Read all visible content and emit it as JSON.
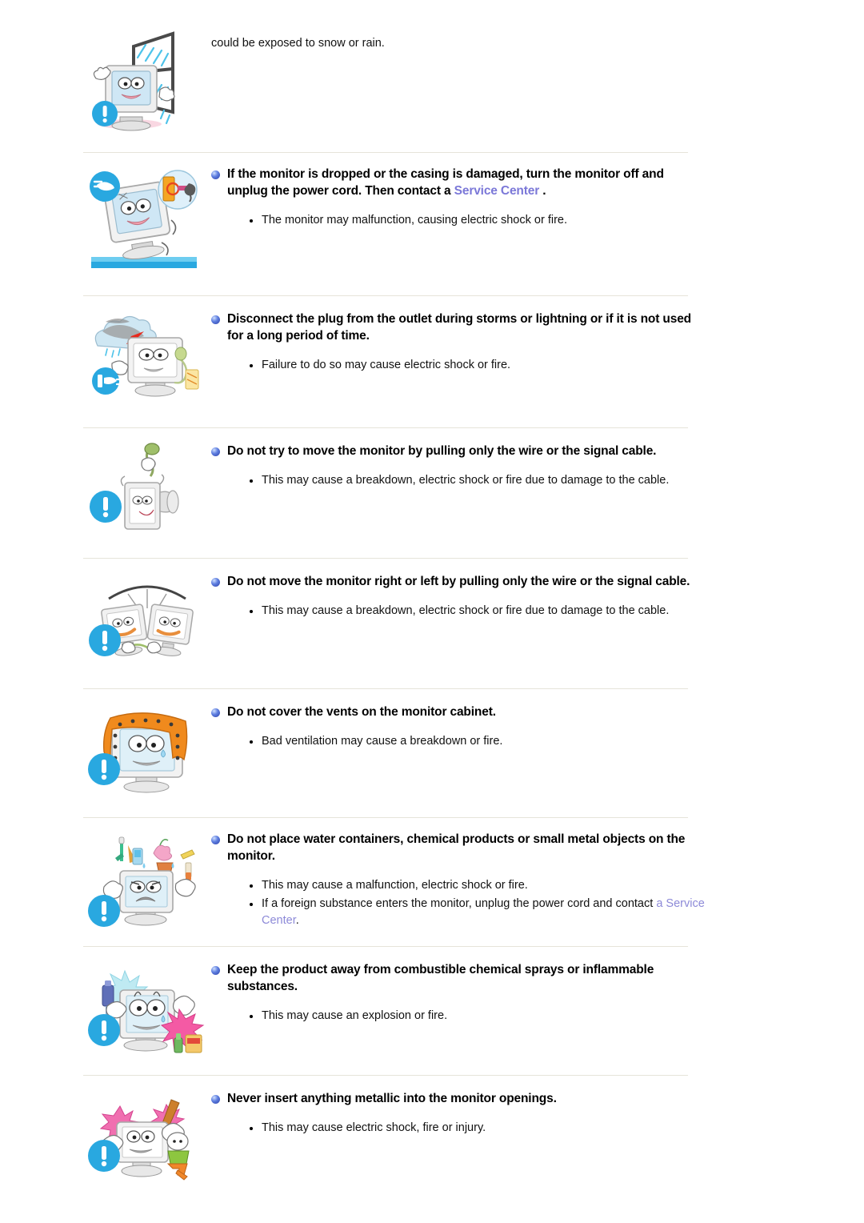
{
  "document": {
    "type": "monitor-safety-manual-page",
    "continued_text": "could be exposed to snow or rain."
  },
  "sections": [
    {
      "id": "snow-rain",
      "kind": "continued",
      "art": "monitor-rain-window",
      "text": "could be exposed to snow or rain."
    },
    {
      "id": "dropped-monitor",
      "kind": "warning",
      "art": "monitor-dropped-cracked",
      "heading_parts": [
        {
          "text": "If the monitor is dropped or the casing is damaged, turn the monitor off and unplug the power cord. Then contact a ",
          "style": "bold"
        },
        {
          "text": "Service Center",
          "style": "link"
        },
        {
          "text": " .",
          "style": "bold"
        }
      ],
      "bullets": [
        "The monitor may malfunction, causing electric shock or fire."
      ]
    },
    {
      "id": "storms-lightning",
      "kind": "warning",
      "art": "monitor-storm-unplug",
      "heading_parts": [
        {
          "text": "Disconnect the plug from the outlet during storms or lightning or if it is not used for a long period of time.",
          "style": "bold"
        }
      ],
      "bullets": [
        "Failure to do so may cause electric shock or fire."
      ]
    },
    {
      "id": "pull-wire-move",
      "kind": "warning",
      "art": "monitor-pull-cable-up",
      "heading_parts": [
        {
          "text": "Do not try to move the monitor by pulling only the wire or the signal cable.",
          "style": "bold"
        }
      ],
      "bullets": [
        "This may cause a breakdown, electric shock or fire due to damage to the cable."
      ]
    },
    {
      "id": "pull-wire-sideways",
      "kind": "warning",
      "art": "monitor-pull-cable-side",
      "heading_parts": [
        {
          "text": "Do not move the monitor right or left by pulling only the wire or the signal cable.",
          "style": "bold"
        }
      ],
      "bullets": [
        "This may cause a breakdown, electric shock or fire due to damage to the cable."
      ]
    },
    {
      "id": "cover-vents",
      "kind": "warning",
      "art": "monitor-covered-cloth",
      "heading_parts": [
        {
          "text": "Do not cover the vents on the monitor cabinet.",
          "style": "bold"
        }
      ],
      "bullets": [
        "Bad ventilation may cause a breakdown or fire."
      ]
    },
    {
      "id": "water-containers",
      "kind": "warning",
      "art": "monitor-objects-on-top",
      "heading_parts": [
        {
          "text": "Do not place water containers, chemical products or small metal objects on the monitor.",
          "style": "bold"
        }
      ],
      "bullets_rich": [
        [
          {
            "text": "This may cause a malfunction, electric shock or fire.",
            "style": "plain"
          }
        ],
        [
          {
            "text": "If a foreign substance enters the monitor, unplug the power cord and contact ",
            "style": "plain"
          },
          {
            "text": "a Service Center",
            "style": "link-light"
          },
          {
            "text": ".",
            "style": "plain"
          }
        ]
      ]
    },
    {
      "id": "combustible-sprays",
      "kind": "warning",
      "art": "monitor-spray-explosion",
      "heading_parts": [
        {
          "text": "Keep the product away from combustible chemical sprays or inflammable substances.",
          "style": "bold"
        }
      ],
      "bullets": [
        "This may cause an explosion or fire."
      ]
    },
    {
      "id": "metallic-openings",
      "kind": "warning",
      "art": "monitor-metal-insert",
      "heading_parts": [
        {
          "text": "Never insert anything metallic into the monitor openings.",
          "style": "bold"
        }
      ],
      "bullets": [
        "This may cause electric shock, fire or injury."
      ]
    }
  ],
  "icons": {
    "heading_bullet": "blue-sphere-bullet-icon",
    "list_bullet": "small-dot-bullet-icon",
    "warning": "exclamation-circle-icon"
  },
  "colors": {
    "link": "#7b78d8",
    "link_light": "#8d8ad8",
    "divider": "#e6e4da",
    "warning_badge": "#29a8e0",
    "text": "#111111"
  }
}
